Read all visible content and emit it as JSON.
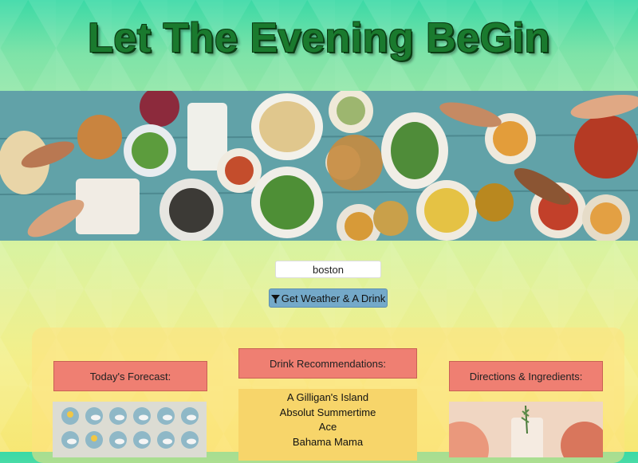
{
  "header": {
    "title": "Let The Evening BeGin"
  },
  "search": {
    "value": "boston"
  },
  "go_button": {
    "label": "Get Weather & A Drink",
    "icon": "filter-icon"
  },
  "forecast": {
    "heading": "Today's Forecast:"
  },
  "drinks": {
    "heading": "Drink Recommendations:",
    "items": [
      "A Gilligan's Island",
      "Absolut Summertime",
      "Ace",
      "Bahama Mama"
    ]
  },
  "directions": {
    "heading": "Directions & Ingredients:"
  },
  "colors": {
    "title_green": "#1a7a2e",
    "heading_bg": "#ef7f72",
    "button_bg": "#74a9c9",
    "drink_list_bg": "#f7d56a"
  }
}
